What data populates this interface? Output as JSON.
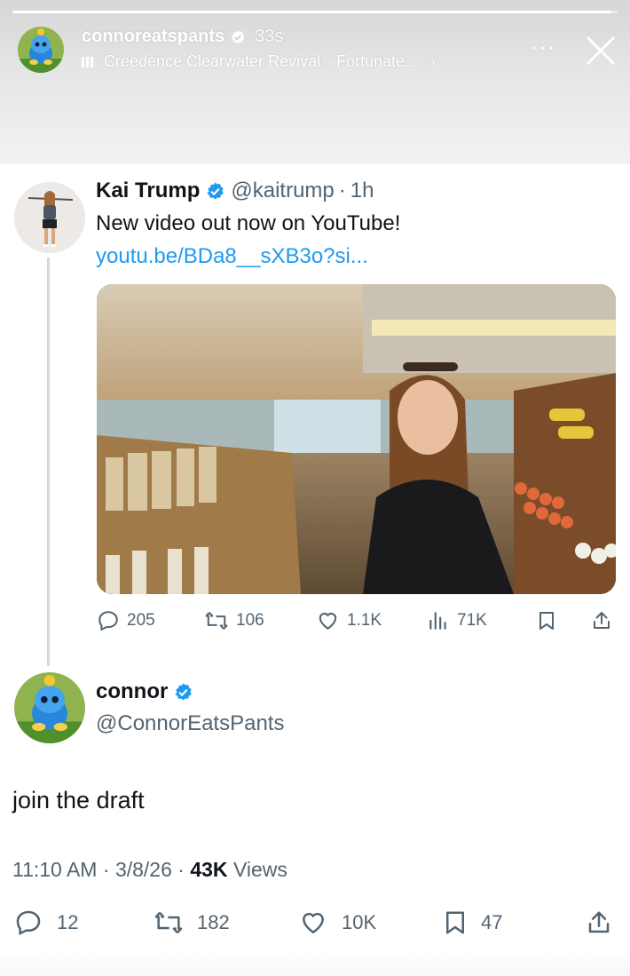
{
  "story": {
    "username": "connoreatspants",
    "time": "33s",
    "music_artist": "Creedence Clearwater Revival",
    "music_separator": "·",
    "music_track": "Fortunate...",
    "progress": 0.99,
    "more_label": "···",
    "chevron": "›"
  },
  "quoted_tweet": {
    "name": "Kai Trump",
    "handle": "@kaitrump",
    "dot": "·",
    "time": "1h",
    "text": "New video out now on YouTube!",
    "link": "youtu.be/BDa8__sXB3o?si...",
    "replies": "205",
    "retweets": "106",
    "likes": "1.1K",
    "views": "71K"
  },
  "reply_tweet": {
    "name": "connor",
    "handle": "@ConnorEatsPants",
    "text": "join the draft",
    "time": "11:10 AM",
    "dot1": "·",
    "date": "3/8/26",
    "dot2": "·",
    "views_count": "43K",
    "views_label": "Views",
    "replies": "12",
    "retweets": "182",
    "likes": "10K",
    "bookmarks": "47"
  },
  "colors": {
    "accent": "#1d9bf0",
    "muted": "#536471",
    "text": "#0f1419"
  }
}
